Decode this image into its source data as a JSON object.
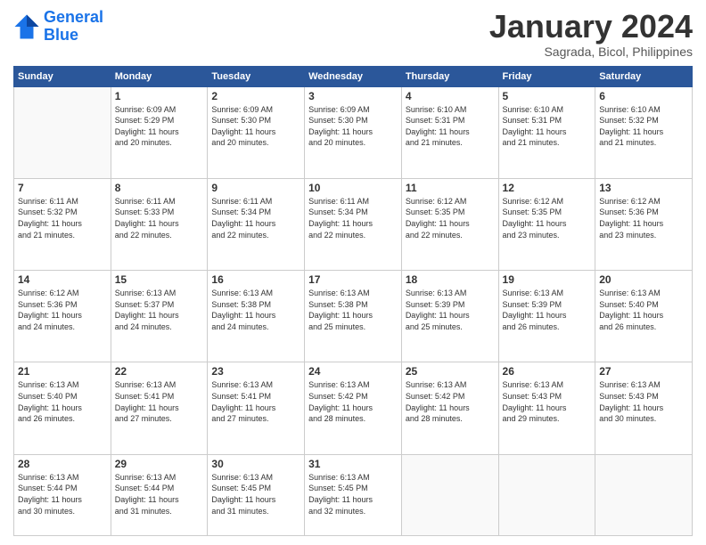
{
  "logo": {
    "line1": "General",
    "line2": "Blue"
  },
  "title": "January 2024",
  "subtitle": "Sagrada, Bicol, Philippines",
  "days_of_week": [
    "Sunday",
    "Monday",
    "Tuesday",
    "Wednesday",
    "Thursday",
    "Friday",
    "Saturday"
  ],
  "weeks": [
    [
      {
        "day": "",
        "info": ""
      },
      {
        "day": "1",
        "info": "Sunrise: 6:09 AM\nSunset: 5:29 PM\nDaylight: 11 hours\nand 20 minutes."
      },
      {
        "day": "2",
        "info": "Sunrise: 6:09 AM\nSunset: 5:30 PM\nDaylight: 11 hours\nand 20 minutes."
      },
      {
        "day": "3",
        "info": "Sunrise: 6:09 AM\nSunset: 5:30 PM\nDaylight: 11 hours\nand 20 minutes."
      },
      {
        "day": "4",
        "info": "Sunrise: 6:10 AM\nSunset: 5:31 PM\nDaylight: 11 hours\nand 21 minutes."
      },
      {
        "day": "5",
        "info": "Sunrise: 6:10 AM\nSunset: 5:31 PM\nDaylight: 11 hours\nand 21 minutes."
      },
      {
        "day": "6",
        "info": "Sunrise: 6:10 AM\nSunset: 5:32 PM\nDaylight: 11 hours\nand 21 minutes."
      }
    ],
    [
      {
        "day": "7",
        "info": "Sunrise: 6:11 AM\nSunset: 5:32 PM\nDaylight: 11 hours\nand 21 minutes."
      },
      {
        "day": "8",
        "info": "Sunrise: 6:11 AM\nSunset: 5:33 PM\nDaylight: 11 hours\nand 22 minutes."
      },
      {
        "day": "9",
        "info": "Sunrise: 6:11 AM\nSunset: 5:34 PM\nDaylight: 11 hours\nand 22 minutes."
      },
      {
        "day": "10",
        "info": "Sunrise: 6:11 AM\nSunset: 5:34 PM\nDaylight: 11 hours\nand 22 minutes."
      },
      {
        "day": "11",
        "info": "Sunrise: 6:12 AM\nSunset: 5:35 PM\nDaylight: 11 hours\nand 22 minutes."
      },
      {
        "day": "12",
        "info": "Sunrise: 6:12 AM\nSunset: 5:35 PM\nDaylight: 11 hours\nand 23 minutes."
      },
      {
        "day": "13",
        "info": "Sunrise: 6:12 AM\nSunset: 5:36 PM\nDaylight: 11 hours\nand 23 minutes."
      }
    ],
    [
      {
        "day": "14",
        "info": "Sunrise: 6:12 AM\nSunset: 5:36 PM\nDaylight: 11 hours\nand 24 minutes."
      },
      {
        "day": "15",
        "info": "Sunrise: 6:13 AM\nSunset: 5:37 PM\nDaylight: 11 hours\nand 24 minutes."
      },
      {
        "day": "16",
        "info": "Sunrise: 6:13 AM\nSunset: 5:38 PM\nDaylight: 11 hours\nand 24 minutes."
      },
      {
        "day": "17",
        "info": "Sunrise: 6:13 AM\nSunset: 5:38 PM\nDaylight: 11 hours\nand 25 minutes."
      },
      {
        "day": "18",
        "info": "Sunrise: 6:13 AM\nSunset: 5:39 PM\nDaylight: 11 hours\nand 25 minutes."
      },
      {
        "day": "19",
        "info": "Sunrise: 6:13 AM\nSunset: 5:39 PM\nDaylight: 11 hours\nand 26 minutes."
      },
      {
        "day": "20",
        "info": "Sunrise: 6:13 AM\nSunset: 5:40 PM\nDaylight: 11 hours\nand 26 minutes."
      }
    ],
    [
      {
        "day": "21",
        "info": "Sunrise: 6:13 AM\nSunset: 5:40 PM\nDaylight: 11 hours\nand 26 minutes."
      },
      {
        "day": "22",
        "info": "Sunrise: 6:13 AM\nSunset: 5:41 PM\nDaylight: 11 hours\nand 27 minutes."
      },
      {
        "day": "23",
        "info": "Sunrise: 6:13 AM\nSunset: 5:41 PM\nDaylight: 11 hours\nand 27 minutes."
      },
      {
        "day": "24",
        "info": "Sunrise: 6:13 AM\nSunset: 5:42 PM\nDaylight: 11 hours\nand 28 minutes."
      },
      {
        "day": "25",
        "info": "Sunrise: 6:13 AM\nSunset: 5:42 PM\nDaylight: 11 hours\nand 28 minutes."
      },
      {
        "day": "26",
        "info": "Sunrise: 6:13 AM\nSunset: 5:43 PM\nDaylight: 11 hours\nand 29 minutes."
      },
      {
        "day": "27",
        "info": "Sunrise: 6:13 AM\nSunset: 5:43 PM\nDaylight: 11 hours\nand 30 minutes."
      }
    ],
    [
      {
        "day": "28",
        "info": "Sunrise: 6:13 AM\nSunset: 5:44 PM\nDaylight: 11 hours\nand 30 minutes."
      },
      {
        "day": "29",
        "info": "Sunrise: 6:13 AM\nSunset: 5:44 PM\nDaylight: 11 hours\nand 31 minutes."
      },
      {
        "day": "30",
        "info": "Sunrise: 6:13 AM\nSunset: 5:45 PM\nDaylight: 11 hours\nand 31 minutes."
      },
      {
        "day": "31",
        "info": "Sunrise: 6:13 AM\nSunset: 5:45 PM\nDaylight: 11 hours\nand 32 minutes."
      },
      {
        "day": "",
        "info": ""
      },
      {
        "day": "",
        "info": ""
      },
      {
        "day": "",
        "info": ""
      }
    ]
  ]
}
